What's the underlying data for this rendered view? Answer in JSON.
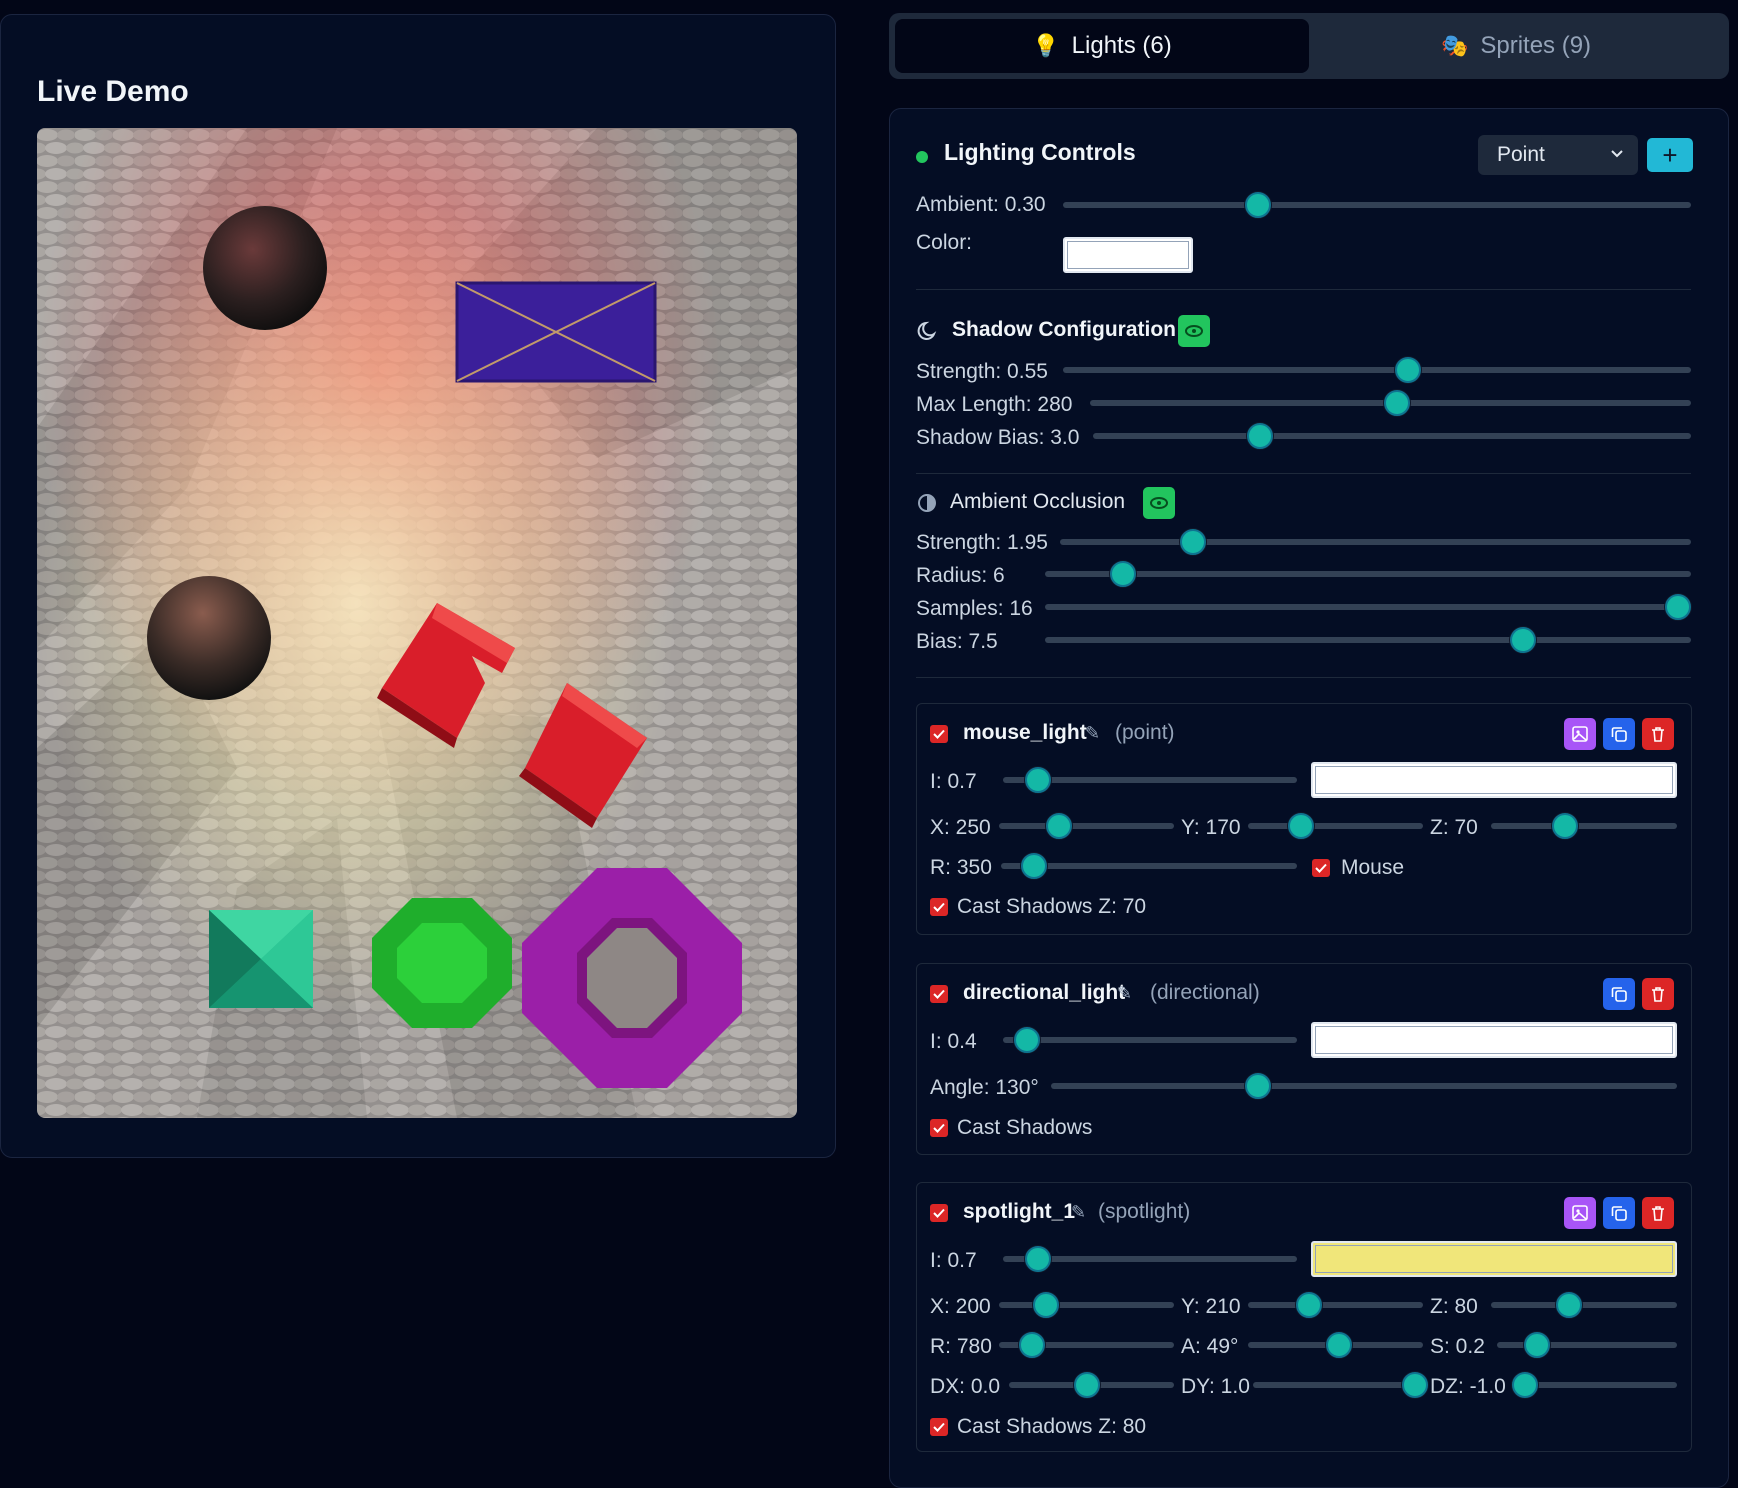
{
  "demo": {
    "title": "Live Demo",
    "scene_objects": [
      "sphere-top",
      "blue-rectangle",
      "sphere-left",
      "red-l-block",
      "red-block",
      "green-square-pyramid",
      "green-octagon-gem",
      "purple-octagon-ring"
    ],
    "colors": {
      "floor": "#b8b2ad",
      "red_light": "#ff6b6b",
      "spot_light": "#fff3b0",
      "blue_rect": "#3b1f9a",
      "red_block": "#d91e2a",
      "teal_pyramid": "#1fb98a",
      "green_gem": "#1fae2c",
      "purple_ring": "#9b1fa8"
    }
  },
  "tabs": [
    {
      "label": "Lights (6)",
      "icon": "lightbulb-icon",
      "active": true
    },
    {
      "label": "Sprites (9)",
      "icon": "sprites-icon",
      "active": false
    }
  ],
  "lighting": {
    "title": "Lighting Controls",
    "type_select": "Point",
    "add_label": "+",
    "ambient_label": "Ambient: 0.30",
    "ambient_value": 0.3,
    "color_label": "Color:",
    "color_value": "#ffffff"
  },
  "shadow": {
    "title": "Shadow Configuration",
    "enabled": true,
    "strength_label": "Strength: 0.55",
    "max_length_label": "Max Length: 280",
    "bias_label": "Shadow Bias: 3.0"
  },
  "ao": {
    "title": "Ambient Occlusion",
    "enabled": true,
    "strength_label": "Strength: 1.95",
    "radius_label": "Radius: 6",
    "samples_label": "Samples: 16",
    "bias_label": "Bias: 7.5"
  },
  "lights": [
    {
      "name": "mouse_light",
      "type": "(point)",
      "enabled": true,
      "i_label": "I: 0.7",
      "color": "#ffffff",
      "x_label": "X: 250",
      "y_label": "Y: 170",
      "z_label": "Z: 70",
      "r_label": "R: 350",
      "mouse_label": "Mouse",
      "cast_label": "Cast Shadows Z: 70"
    },
    {
      "name": "directional_light",
      "type": "(directional)",
      "enabled": true,
      "i_label": "I: 0.4",
      "color": "#ffffff",
      "angle_label": "Angle: 130°",
      "cast_label": "Cast Shadows"
    },
    {
      "name": "spotlight_1",
      "type": "(spotlight)",
      "enabled": true,
      "i_label": "I: 0.7",
      "color": "#f0e67a",
      "x_label": "X: 200",
      "y_label": "Y: 210",
      "z_label": "Z: 80",
      "r_label": "R: 780",
      "a_label": "A: 49°",
      "s_label": "S: 0.2",
      "dx_label": "DX: 0.0",
      "dy_label": "DY: 1.0",
      "dz_label": "DZ: -1.0",
      "cast_label": "Cast Shadows Z: 80"
    }
  ]
}
